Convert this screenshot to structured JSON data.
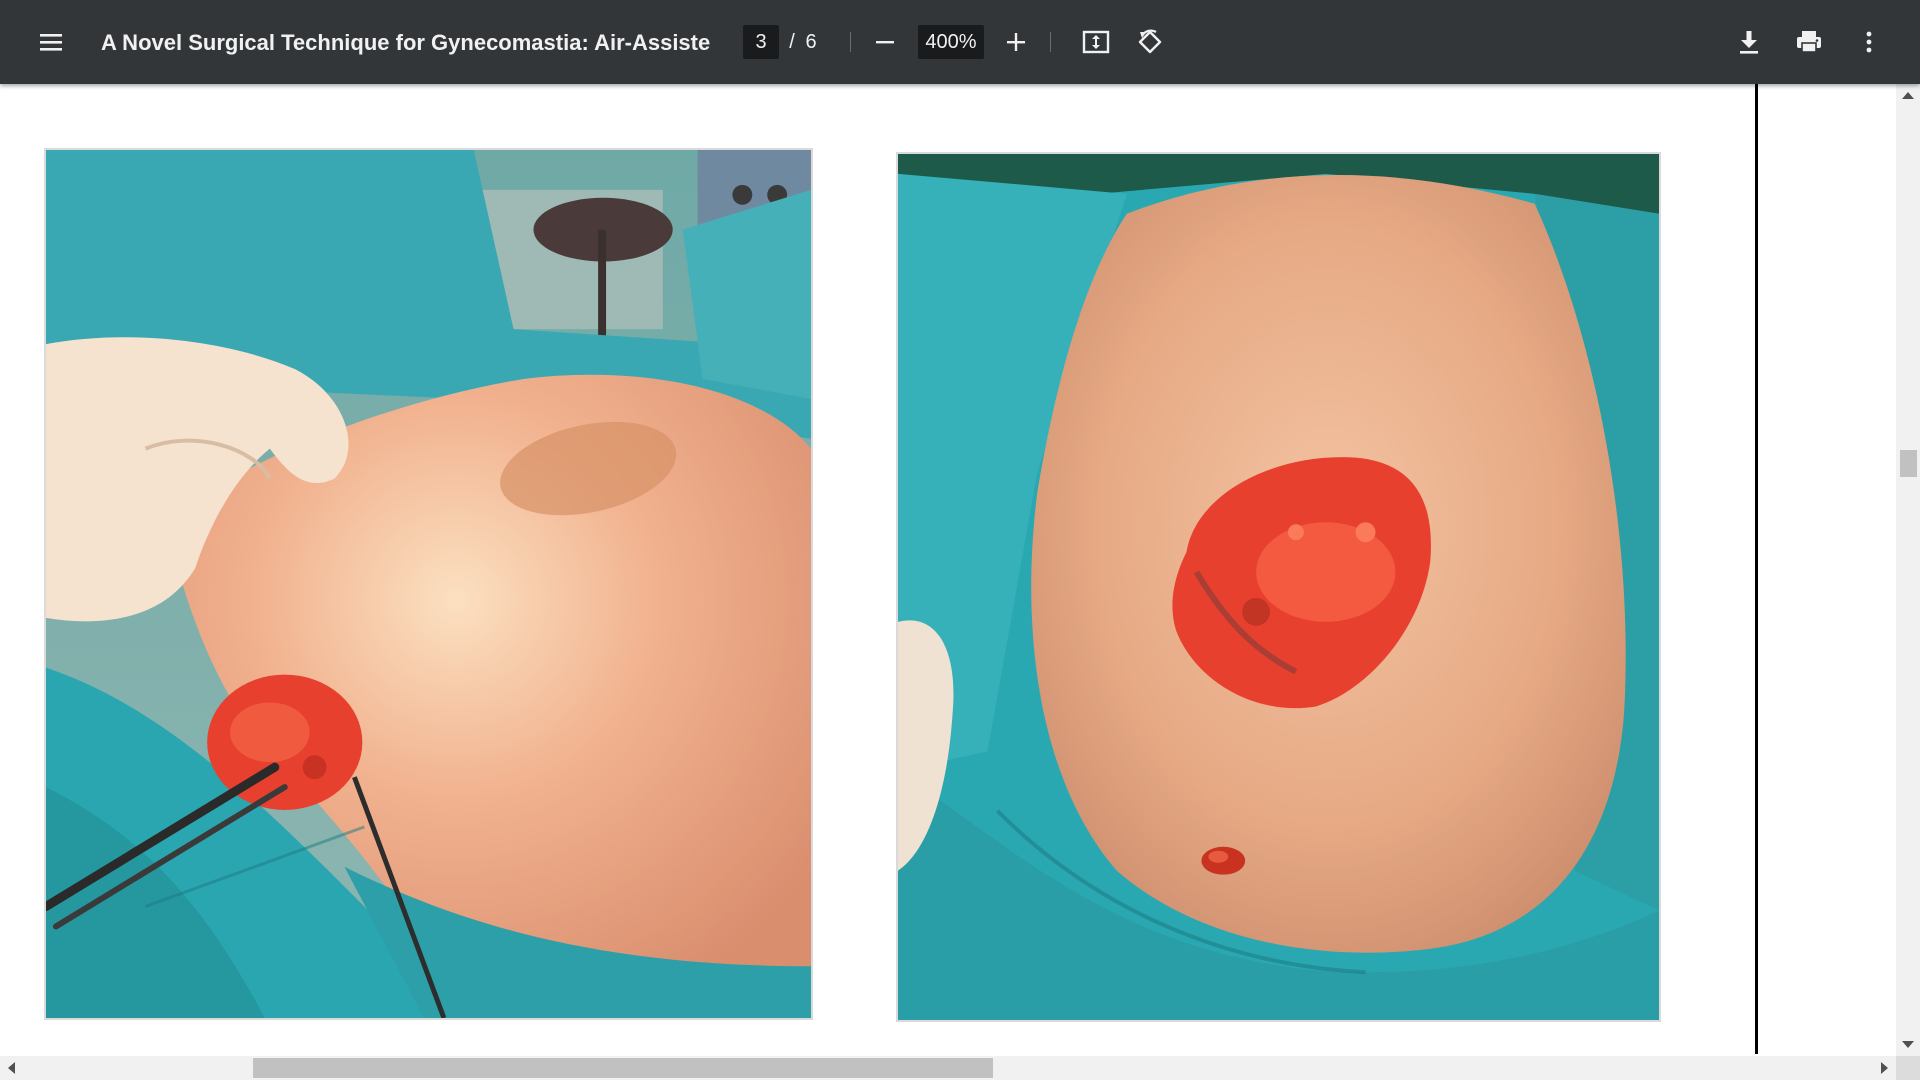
{
  "toolbar": {
    "title": "A Novel Surgical Technique for Gynecomastia: Air-Assisted Mi...",
    "current_page": "3",
    "page_separator": "/",
    "total_pages": "6",
    "zoom": "400%",
    "icons": {
      "menu": "menu-icon",
      "zoom_out": "minus-icon",
      "zoom_in": "plus-icon",
      "fit": "fit-to-page-icon",
      "rotate": "rotate-counterclockwise-icon",
      "download": "download-icon",
      "print": "print-icon",
      "more": "more-vertical-icon"
    }
  },
  "figures": [
    {
      "id": "left",
      "subject": "surgical-photo-excision-through-inferior-incision"
    },
    {
      "id": "right",
      "subject": "surgical-photo-excised-glandular-tissue-on-chest"
    }
  ],
  "colors": {
    "toolbar_bg": "#323639",
    "toolbar_text": "#f1f1f1",
    "drape": "#2fa8b0",
    "skin": "#e9a883",
    "tissue": "#e8402e"
  }
}
